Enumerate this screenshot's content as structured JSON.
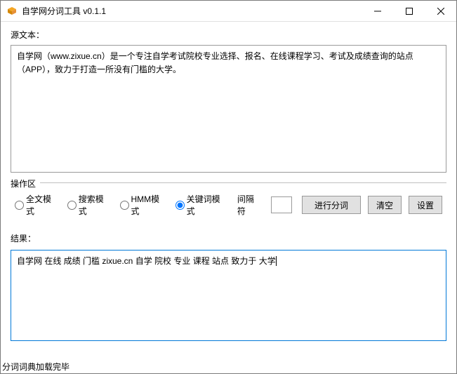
{
  "window": {
    "title": "自学网分词工具 v0.1.1"
  },
  "source": {
    "label": "源文本：",
    "text": "自学网（www.zixue.cn）是一个专注自学考试院校专业选择、报名、在线课程学习、考试及成绩查询的站点（APP），致力于打造一所没有门槛的大学。"
  },
  "operation": {
    "group_label": "操作区",
    "modes": {
      "full": "全文模式",
      "search": "搜索模式",
      "hmm": "HMM模式",
      "keyword": "关键词模式"
    },
    "selected_mode": "keyword",
    "separator_label": "间隔符",
    "separator_value": "",
    "buttons": {
      "run": "进行分词",
      "clear": "清空",
      "settings": "设置"
    }
  },
  "result": {
    "label": "结果：",
    "text": "自学网 在线 成绩 门槛 zixue.cn 自学 院校 专业 课程 站点 致力于 大学"
  },
  "status": {
    "text": "分词词典加载完毕"
  }
}
